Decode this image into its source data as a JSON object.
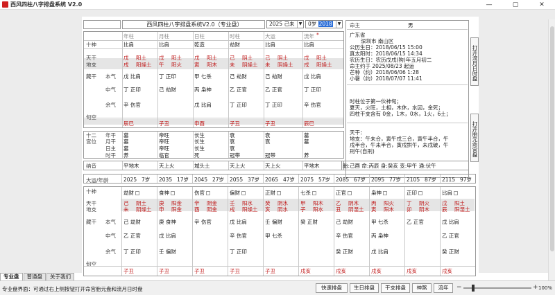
{
  "window": {
    "title": "西风四柱八字排盘系统 V2.0",
    "min": "—",
    "max": "▢",
    "close": "✕"
  },
  "header": {
    "app_title": "西风四柱八字排盘系统V2.0（专业盘）",
    "year_select": "2025 己未",
    "age_select_prefix": "0岁",
    "age_select_hl": "2018"
  },
  "info": {
    "mingzhu_label": "命主",
    "gender": "男",
    "province": "广东省",
    "city": "深圳市  南山区",
    "lines": [
      "公历生日：2018/06/15 15:00",
      "真太阳时：2018/06/15 14:34",
      "农历生日：农历戊戌(狗)年五月初二",
      "命主约于 2025/08/23 起运",
      "芒种（约）2018/06/06  1:28",
      "小暑（约）2018/07/07  11:41"
    ],
    "desc": [
      "时柱位于第一伙神旬；",
      "夏天，火旺，土相，木休，水囚，金死；",
      "四柱干支含有 0金，1木，0水，1火，6土；"
    ],
    "tiangan": "天干：",
    "dizhi": [
      "地支：午未合，寅午戌三合，寅午半合，午",
      "戌半合，午未半合，寅戌拱午，未戌破，午",
      "刑午(自刑)"
    ]
  },
  "side_buttons": {
    "top": "打开流月日时盘",
    "bottom": "打开胎元命宫盘"
  },
  "labels": {
    "shishen": "十神",
    "tiangan": "天干",
    "dizhi": "地支",
    "canggan": "藏干",
    "benqi": "本气",
    "zhongqi": "中气",
    "yuqi": "余气",
    "xunkong": "旬空",
    "shier": "十二",
    "gongwei": "宫位",
    "nianzhi": "年干",
    "yuezhi": "月干",
    "rizhu": "日主",
    "shigan": "时干",
    "nayin": "纳音",
    "dayun": "大运/年龄"
  },
  "pillars": [
    {
      "name": "年柱",
      "shishen": "比肩",
      "gan": "戊",
      "gan_wx": "阳土",
      "zhi": "戌",
      "zhi_wx": "阳燥土",
      "cg1": "戊  比肩",
      "cg2": "丁  正印",
      "cg3": "辛  伤官",
      "xk": "辰巳",
      "s1": "墓",
      "s2": "墓",
      "s3": "墓",
      "s4": "养",
      "nayin": "平地木"
    },
    {
      "name": "月柱",
      "shishen": "比肩",
      "gan": "戊",
      "gan_wx": "阳土",
      "zhi": "午",
      "zhi_wx": "阳火",
      "cg1": "丁  正印",
      "cg2": "己  劫财",
      "cg3": "",
      "xk": "子丑",
      "s1": "帝旺",
      "s2": "帝旺",
      "s3": "帝旺",
      "s4": "临官",
      "nayin": "天上火"
    },
    {
      "name": "日柱",
      "shishen": "乾造",
      "gan": "戊",
      "gan_wx": "阳土",
      "zhi": "寅",
      "zhi_wx": "阳木",
      "cg1": "甲  七杀",
      "cg2": "丙  枭神",
      "cg3": "戊  比肩",
      "xk": "申酉",
      "s1": "长生",
      "s2": "长生",
      "s3": "长生",
      "s4": "死",
      "nayin": "城头土"
    },
    {
      "name": "时柱",
      "shishen": "劫财",
      "gan": "己",
      "gan_wx": "阴土",
      "zhi": "未",
      "zhi_wx": "阴燥土",
      "cg1": "己  劫财",
      "cg2": "乙  正官",
      "cg3": "丁  正印",
      "xk": "子丑",
      "s1": "衰",
      "s2": "衰",
      "s3": "衰",
      "s4": "冠带",
      "nayin": "天上火"
    },
    {
      "name": "大运",
      "shishen": "比肩",
      "gan": "己",
      "gan_wx": "阴土",
      "zhi": "未",
      "zhi_wx": "阴燥土",
      "cg1": "己  劫财",
      "cg2": "乙  正官",
      "cg3": "丁  正印",
      "xk": "子丑",
      "s1": "衰",
      "s2": "衰",
      "s3": "",
      "s4": "冠带",
      "nayin": "天上火"
    },
    {
      "name": "流年",
      "shishen": "比肩",
      "gan": "戊",
      "gan_wx": "阳土",
      "zhi": "戌",
      "zhi_wx": "阳燥土",
      "cg1": "戊  比肩",
      "cg2": "丁  正印",
      "cg3": "辛  伤官",
      "xk": "辰巳",
      "s1": "墓",
      "s2": "墓",
      "s3": "",
      "s4": "养",
      "nayin": "平地木"
    }
  ],
  "summary": "胎:己酉  命:丙辰  身:癸亥  变:甲午  通:伏午",
  "dayun": [
    {
      "year": "2025",
      "age": "7岁",
      "shishen": "劫财",
      "gan": "己",
      "gan_wx": "阴土",
      "zhi": "未",
      "zhi_wx": "阴燥土",
      "cg1": "己  劫财",
      "cg2": "乙  正官",
      "cg3": "丁  正印",
      "xk": "子丑"
    },
    {
      "year": "2035",
      "age": "17岁",
      "shishen": "食神",
      "gan": "庚",
      "gan_wx": "阳金",
      "zhi": "申",
      "zhi_wx": "阳金",
      "cg1": "庚  食神",
      "cg2": "戊  比肩",
      "cg3": "壬  偏财",
      "xk": "子丑"
    },
    {
      "year": "2045",
      "age": "27岁",
      "shishen": "伤官",
      "gan": "辛",
      "gan_wx": "阴金",
      "zhi": "酉",
      "zhi_wx": "阴金",
      "cg1": "辛  伤官",
      "cg2": "",
      "cg3": "",
      "xk": "子丑"
    },
    {
      "year": "2055",
      "age": "37岁",
      "shishen": "偏财",
      "gan": "壬",
      "gan_wx": "阳水",
      "zhi": "戌",
      "zhi_wx": "阳燥土",
      "cg1": "戊  比肩",
      "cg2": "辛  伤官",
      "cg3": "丁  正印",
      "xk": "子丑"
    },
    {
      "year": "2065",
      "age": "47岁",
      "shishen": "正财",
      "gan": "癸",
      "gan_wx": "阴水",
      "zhi": "亥",
      "zhi_wx": "阴水",
      "cg1": "壬  偏财",
      "cg2": "甲  七杀",
      "cg3": "",
      "xk": "子丑"
    },
    {
      "year": "2075",
      "age": "57岁",
      "shishen": "七杀",
      "gan": "甲",
      "gan_wx": "阳木",
      "zhi": "子",
      "zhi_wx": "阳水",
      "cg1": "癸  正财",
      "cg2": "",
      "cg3": "",
      "xk": "戌亥"
    },
    {
      "year": "2085",
      "age": "67岁",
      "shishen": "正官",
      "gan": "乙",
      "gan_wx": "阴木",
      "zhi": "丑",
      "zhi_wx": "阴湿土",
      "cg1": "己  劫财",
      "cg2": "辛  伤官",
      "cg3": "癸  正财",
      "xk": "戌亥"
    },
    {
      "year": "2095",
      "age": "77岁",
      "shishen": "枭神",
      "gan": "丙",
      "gan_wx": "阳火",
      "zhi": "寅",
      "zhi_wx": "阳木",
      "cg1": "甲  七杀",
      "cg2": "丙  枭神",
      "cg3": "戊  比肩",
      "xk": "戌亥"
    },
    {
      "year": "2105",
      "age": "87岁",
      "shishen": "正印",
      "gan": "丁",
      "gan_wx": "阴火",
      "zhi": "卯",
      "zhi_wx": "阴木",
      "cg1": "乙  正官",
      "cg2": "",
      "cg3": "",
      "xk": "戌亥"
    },
    {
      "year": "2115",
      "age": "97岁",
      "shishen": "比肩",
      "gan": "戊",
      "gan_wx": "阳土",
      "zhi": "辰",
      "zhi_wx": "阳湿土",
      "cg1": "戊  比肩",
      "cg2": "乙  正官",
      "cg3": "癸  正财",
      "xk": "戌亥"
    }
  ],
  "tabs": [
    "专业盘",
    "普通盘",
    "关于我们"
  ],
  "status": {
    "text": "专业盘界面：可通过右上侧按钮打开命宫胎元盘和流月日时盘",
    "buttons": [
      "快速排盘",
      "生日排盘",
      "干支排盘",
      "神煞",
      "流年"
    ],
    "zoom": "100%",
    "zoom_minus": "−",
    "zoom_plus": "+"
  }
}
